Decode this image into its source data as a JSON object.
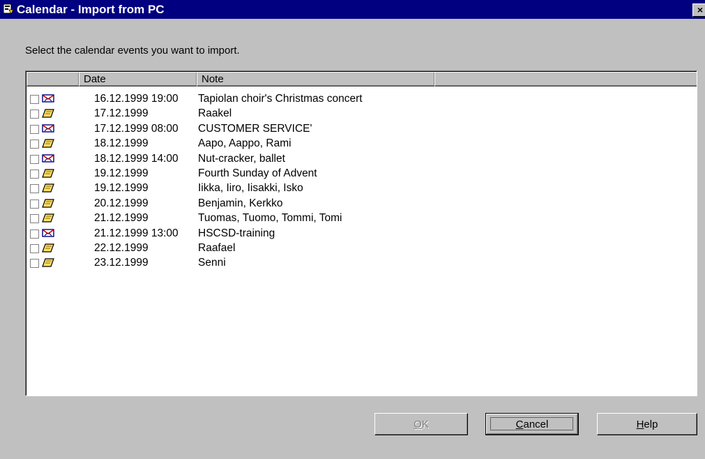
{
  "window": {
    "title": "Calendar - Import from PC",
    "close_glyph": "×"
  },
  "instruction": "Select the calendar events you want to import.",
  "columns": [
    "",
    "Date",
    "Note",
    ""
  ],
  "rows": [
    {
      "checked": false,
      "icon": "meeting-icon",
      "date": "16.12.1999 19:00",
      "note": "Tapiolan choir's Christmas concert"
    },
    {
      "checked": false,
      "icon": "memo-icon",
      "date": "17.12.1999",
      "note": "Raakel"
    },
    {
      "checked": false,
      "icon": "meeting-icon",
      "date": "17.12.1999 08:00",
      "note": "CUSTOMER SERVICE'"
    },
    {
      "checked": false,
      "icon": "memo-icon",
      "date": "18.12.1999",
      "note": "Aapo, Aappo, Rami"
    },
    {
      "checked": false,
      "icon": "meeting-icon",
      "date": "18.12.1999 14:00",
      "note": "Nut-cracker, ballet"
    },
    {
      "checked": false,
      "icon": "memo-icon",
      "date": "19.12.1999",
      "note": "Fourth Sunday of Advent"
    },
    {
      "checked": false,
      "icon": "memo-icon",
      "date": "19.12.1999",
      "note": "Iikka, Iiro, Iisakki, Isko"
    },
    {
      "checked": false,
      "icon": "memo-icon",
      "date": "20.12.1999",
      "note": "Benjamin, Kerkko"
    },
    {
      "checked": false,
      "icon": "memo-icon",
      "date": "21.12.1999",
      "note": "Tuomas, Tuomo, Tommi, Tomi"
    },
    {
      "checked": false,
      "icon": "meeting-icon",
      "date": "21.12.1999 13:00",
      "note": "HSCSD-training"
    },
    {
      "checked": false,
      "icon": "memo-icon",
      "date": "22.12.1999",
      "note": "Raafael"
    },
    {
      "checked": false,
      "icon": "memo-icon",
      "date": "23.12.1999",
      "note": "Senni"
    }
  ],
  "buttons": {
    "ok": {
      "label": "OK",
      "enabled": false
    },
    "cancel": {
      "label": "Cancel",
      "enabled": true
    },
    "help": {
      "label": "Help",
      "enabled": true
    }
  },
  "colors": {
    "titlebar": "#000080",
    "face": "#c0c0c0",
    "list_bg": "#ffffff"
  }
}
